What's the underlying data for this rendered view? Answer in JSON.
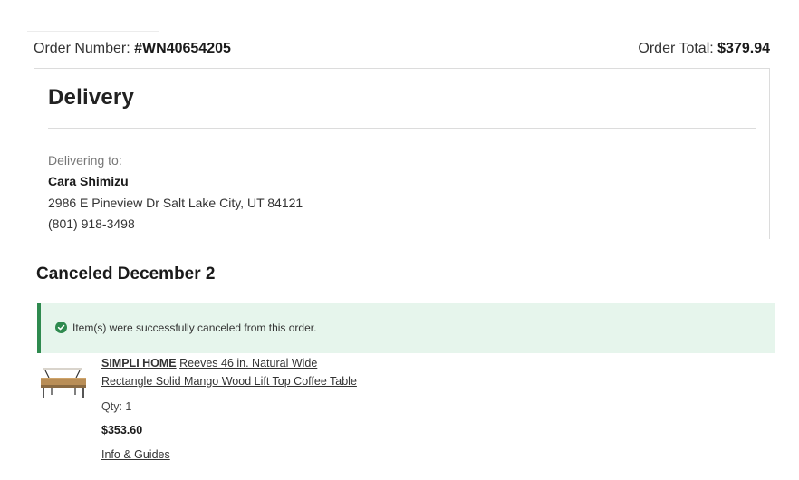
{
  "order": {
    "number_label": "Order Number: ",
    "number_value": "#WN40654205",
    "total_label": "Order Total: ",
    "total_value": "$379.94"
  },
  "delivery": {
    "title": "Delivery",
    "delivering_label": "Delivering to:",
    "name": "Cara Shimizu",
    "address": "2986 E Pineview Dr Salt Lake City, UT 84121",
    "phone": "(801) 918-3498"
  },
  "cancellation": {
    "heading": "Canceled December 2",
    "banner_text": "Item(s) were successfully canceled from this order.",
    "status_color": "#2f8a4f",
    "banner_bg": "#e6f5ec"
  },
  "item": {
    "brand": "SIMPLI HOME",
    "title_line1": "Reeves 46 in. Natural Wide",
    "title_line2": "Rectangle Solid Mango Wood Lift Top Coffee Table",
    "qty": "Qty: 1",
    "price": "$353.60",
    "info_link": "Info & Guides",
    "image_icon": "coffee-table-image"
  }
}
